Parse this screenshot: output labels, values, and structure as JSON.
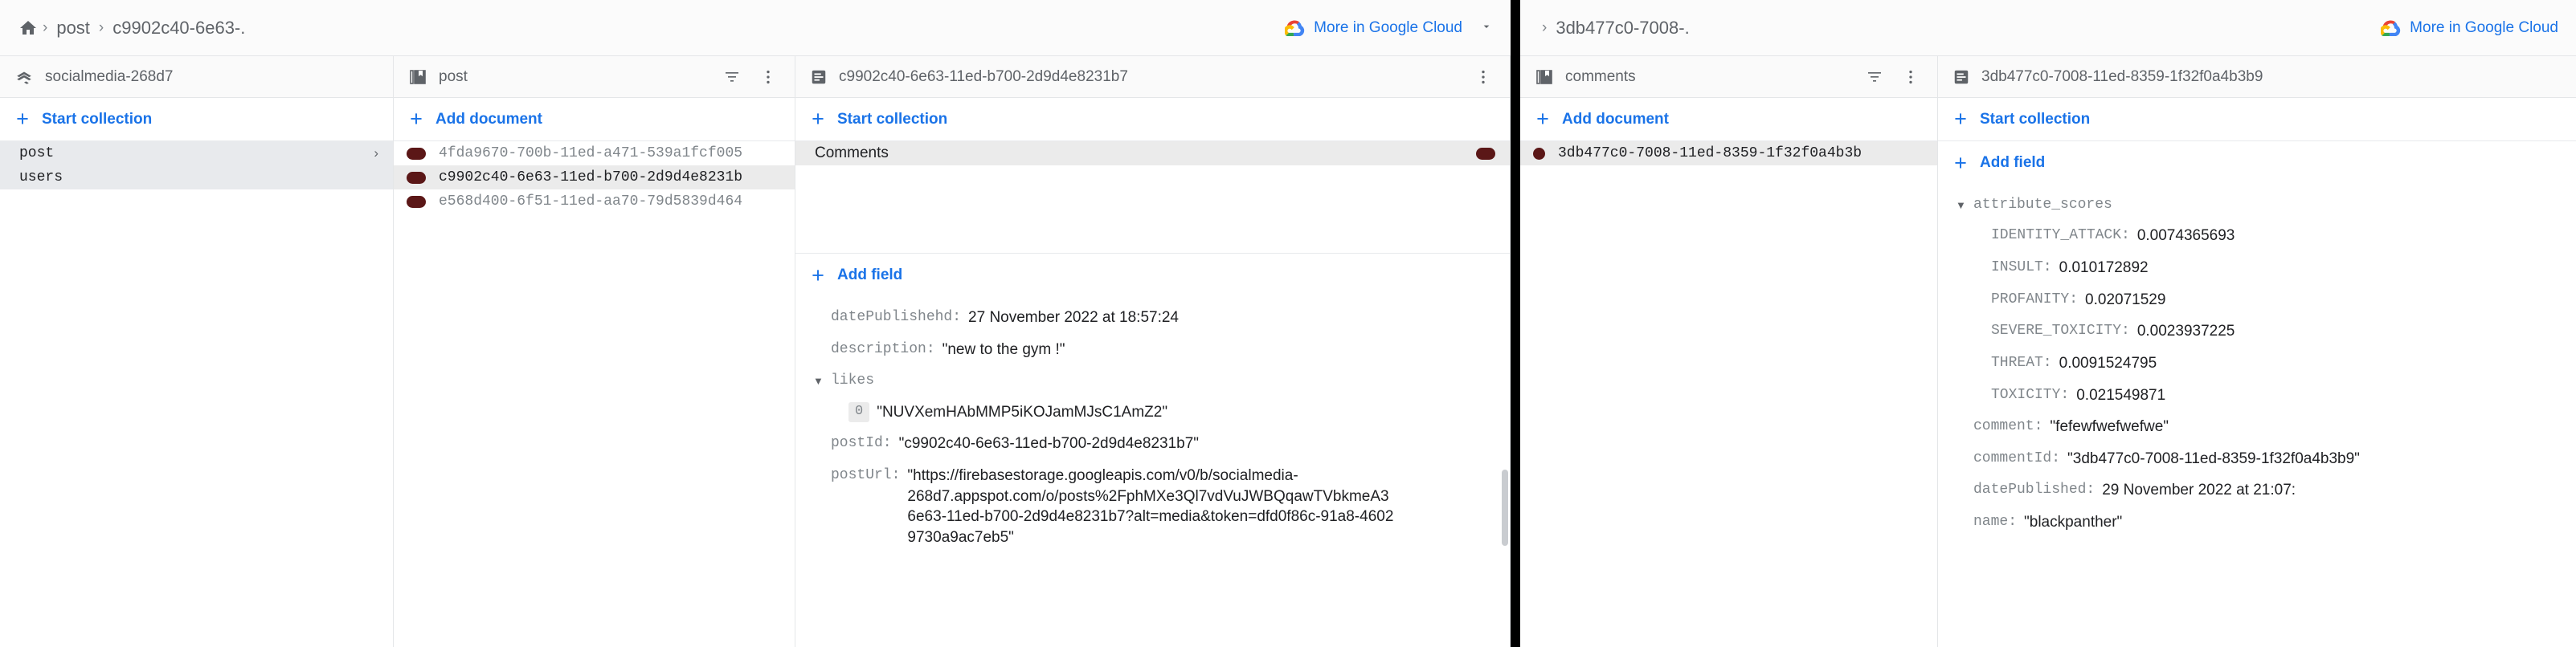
{
  "windows": {
    "left": {
      "breadcrumb": {
        "home_icon": "home-icon",
        "items": [
          "post",
          "c9902c40-6e63-."
        ],
        "separator": "›"
      },
      "google_cloud_link": {
        "label": "More in Google Cloud",
        "icon": "google-cloud-icon",
        "chevron": "⌄"
      },
      "columns": {
        "database": {
          "header_title": "socialmedia-268d7",
          "header_icon": "firestore-database-icon",
          "action_label": "Start collection",
          "action_icon": "plus-icon",
          "items": [
            {
              "label": "post",
              "selected": true,
              "has_chevron": true,
              "chevron": "›"
            },
            {
              "label": "users",
              "selected": true,
              "has_chevron": false,
              "chevron": ""
            }
          ]
        },
        "collection": {
          "header_title": "post",
          "header_icon": "collection-icon",
          "filter_icon": "filter-icon",
          "menu_icon": "more-vert-icon",
          "action_label": "Add document",
          "action_icon": "plus-icon",
          "documents": [
            {
              "id": "4fda9670-700b-11ed-a471-539a1fcf005",
              "selected": false
            },
            {
              "id": "c9902c40-6e63-11ed-b700-2d9d4e8231b",
              "selected": true
            },
            {
              "id": "e568d400-6f51-11ed-aa70-79d5839d464",
              "selected": false
            }
          ]
        },
        "document": {
          "header_title": "c9902c40-6e63-11ed-b700-2d9d4e8231b7",
          "header_icon": "document-icon",
          "start_collection_label": "Start collection",
          "start_collection_icon": "plus-icon",
          "subcollection": {
            "name": "Comments",
            "dot": "document-dot"
          },
          "add_field_label": "Add field",
          "add_field_icon": "plus-icon",
          "fields": [
            {
              "key": "datePublishehd:",
              "value": "27 November 2022 at 18:57:24",
              "indent": 1,
              "type": "timestamp"
            },
            {
              "key": "description:",
              "value": "\"new to the gym !\"",
              "indent": 1,
              "type": "string"
            },
            {
              "key": "likes",
              "value": "",
              "indent": 0,
              "type": "array",
              "caret": "▼"
            },
            {
              "key": "0",
              "value": "\"NUVXemHAbMMP5iKOJamMJsC1AmZ2\"",
              "indent": 2,
              "type": "array-item"
            },
            {
              "key": "postId:",
              "value": "\"c9902c40-6e63-11ed-b700-2d9d4e8231b7\"",
              "indent": 1,
              "type": "string"
            },
            {
              "key": "postUrl:",
              "value": "\"https://firebasestorage.googleapis.com/v0/b/socialmedia-268d7.appspot.com/o/posts%2FphMXe3Ql7vdVuJWBQqawTVbkmeA3%9730a9ac7eb5\"",
              "indent": 1,
              "type": "string"
            }
          ],
          "post_url_lines": [
            "\"https://firebasestorage.googleapis.com/v0/b/socialmedia-",
            "268d7.appspot.com/o/posts%2FphMXe3Ql7vdVuJWBQqawTVbkmeA3",
            "6e63-11ed-b700-2d9d4e8231b7?alt=media&token=dfd0f86c-91a8-4602",
            "9730a9ac7eb5\""
          ]
        }
      }
    },
    "right": {
      "breadcrumb": {
        "items": [
          "3db477c0-7008-."
        ],
        "separator": "›"
      },
      "google_cloud_link": {
        "label": "More in Google Cloud",
        "icon": "google-cloud-icon"
      },
      "columns": {
        "collection": {
          "header_title": "comments",
          "header_icon": "collection-icon",
          "filter_icon": "filter-icon",
          "menu_icon": "more-vert-icon",
          "action_label": "Add document",
          "action_icon": "plus-icon",
          "documents": [
            {
              "id": "3db477c0-7008-11ed-8359-1f32f0a4b3b",
              "selected": true
            }
          ]
        },
        "document": {
          "header_title": "3db477c0-7008-11ed-8359-1f32f0a4b3b9",
          "header_icon": "document-icon",
          "start_collection_label": "Start collection",
          "start_collection_icon": "plus-icon",
          "add_field_label": "Add field",
          "add_field_icon": "plus-icon",
          "fields": [
            {
              "key": "attribute_scores",
              "value": "",
              "indent": 0,
              "type": "map",
              "caret": "▼"
            },
            {
              "key": "IDENTITY_ATTACK:",
              "value": "0.0074365693",
              "indent": 2,
              "type": "number"
            },
            {
              "key": "INSULT:",
              "value": "0.010172892",
              "indent": 2,
              "type": "number"
            },
            {
              "key": "PROFANITY:",
              "value": "0.02071529",
              "indent": 2,
              "type": "number"
            },
            {
              "key": "SEVERE_TOXICITY:",
              "value": "0.0023937225",
              "indent": 2,
              "type": "number"
            },
            {
              "key": "THREAT:",
              "value": "0.0091524795",
              "indent": 2,
              "type": "number"
            },
            {
              "key": "TOXICITY:",
              "value": "0.021549871",
              "indent": 2,
              "type": "number"
            },
            {
              "key": "comment:",
              "value": "\"fefewfwefwefwe\"",
              "indent": 1,
              "type": "string"
            },
            {
              "key": "commentId:",
              "value": "\"3db477c0-7008-11ed-8359-1f32f0a4b3b9\"",
              "indent": 1,
              "type": "string"
            },
            {
              "key": "datePublished:",
              "value": "29 November 2022 at 21:07:",
              "indent": 1,
              "type": "timestamp"
            },
            {
              "key": "name:",
              "value": "\"blackpanther\"",
              "indent": 1,
              "type": "string"
            }
          ]
        }
      }
    }
  },
  "colors": {
    "accent_blue": "#1a73e8",
    "doc_dot_maroon": "#5b1717",
    "selected_grey": "#e8eaed",
    "text_grey": "#5f6368",
    "text_dark": "#202124"
  }
}
